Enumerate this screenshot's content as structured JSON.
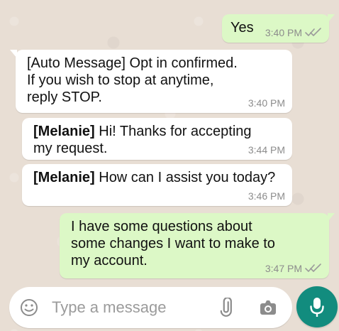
{
  "conversation": {
    "messages": [
      {
        "direction": "outgoing",
        "text": "Yes",
        "time": "3:40 PM",
        "status_icon": "double-check-icon"
      },
      {
        "direction": "incoming",
        "text": "[Auto Message] Opt in confirmed.\nIf you wish to stop at anytime,\nreply STOP.",
        "time": "3:40 PM"
      },
      {
        "direction": "incoming",
        "sender": "[Melanie]",
        "text": " Hi! Thanks for accepting\nmy request.",
        "time": "3:44 PM"
      },
      {
        "direction": "incoming",
        "sender": "[Melanie]",
        "text": " How can I assist you today?",
        "time": "3:46 PM"
      },
      {
        "direction": "outgoing",
        "text": "I have some questions about\nsome changes I want to make to\nmy account.",
        "time": "3:47 PM",
        "status_icon": "double-check-icon"
      }
    ]
  },
  "composer": {
    "placeholder": "Type a message",
    "icons": {
      "emoji": "emoji-icon",
      "attach": "paperclip-icon",
      "camera": "camera-icon",
      "mic": "mic-icon"
    }
  },
  "colors": {
    "chat_background": "#e8ded4",
    "incoming_bubble": "#ffffff",
    "outgoing_bubble": "#dcf8c6",
    "timestamp": "#8c8c8c",
    "mic_button": "#128c7e"
  }
}
